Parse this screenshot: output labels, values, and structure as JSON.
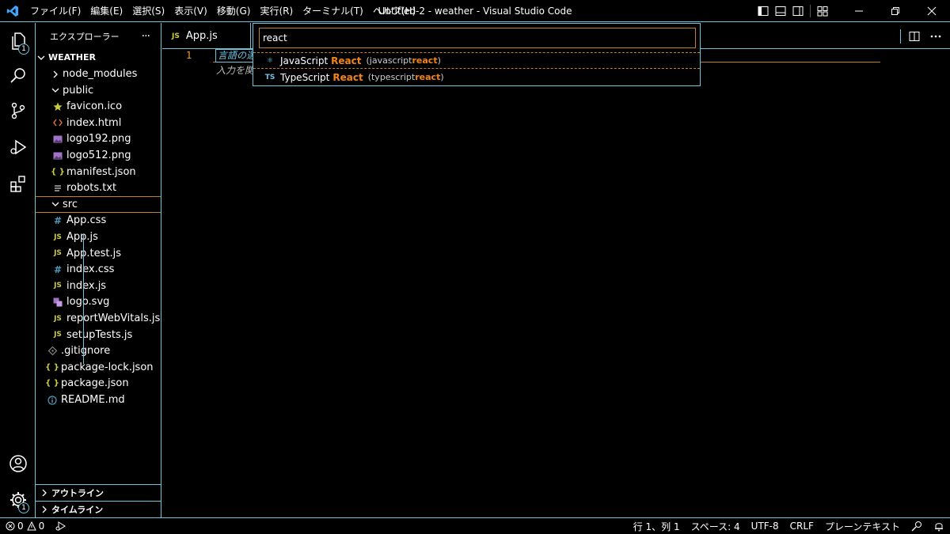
{
  "titlebar": {
    "menus": [
      "ファイル(F)",
      "編集(E)",
      "選択(S)",
      "表示(V)",
      "移動(G)",
      "実行(R)",
      "ターミナル(T)",
      "ヘルプ(H)"
    ],
    "title": "Untitled-2 - weather - Visual Studio Code"
  },
  "activity": {
    "explorer_badge": "1",
    "settings_badge": "1"
  },
  "sidebar": {
    "header": "エクスプローラー",
    "more": "···",
    "root": "WEATHER",
    "items": [
      {
        "label": "node_modules",
        "icon": "chevron-right",
        "indent": 1
      },
      {
        "label": "public",
        "icon": "chevron-down",
        "indent": 1
      },
      {
        "label": "favicon.ico",
        "icon": "star-icon",
        "indent": 2
      },
      {
        "label": "index.html",
        "icon": "html-icon",
        "indent": 2
      },
      {
        "label": "logo192.png",
        "icon": "image-icon",
        "indent": 2
      },
      {
        "label": "logo512.png",
        "icon": "image-icon",
        "indent": 2
      },
      {
        "label": "manifest.json",
        "icon": "json-icon",
        "indent": 2
      },
      {
        "label": "robots.txt",
        "icon": "text-icon",
        "indent": 2
      },
      {
        "label": "src",
        "icon": "chevron-down",
        "indent": 1
      },
      {
        "label": "App.css",
        "icon": "css-icon",
        "indent": 2
      },
      {
        "label": "App.js",
        "icon": "js-icon",
        "indent": 2
      },
      {
        "label": "App.test.js",
        "icon": "js-icon",
        "indent": 2
      },
      {
        "label": "index.css",
        "icon": "css-icon",
        "indent": 2
      },
      {
        "label": "index.js",
        "icon": "js-icon",
        "indent": 2
      },
      {
        "label": "logo.svg",
        "icon": "svg-icon",
        "indent": 2
      },
      {
        "label": "reportWebVitals.js",
        "icon": "js-icon",
        "indent": 2
      },
      {
        "label": "setupTests.js",
        "icon": "js-icon",
        "indent": 2
      },
      {
        "label": ".gitignore",
        "icon": "git-icon",
        "indent": 1
      },
      {
        "label": "package-lock.json",
        "icon": "json-icon",
        "indent": 1
      },
      {
        "label": "package.json",
        "icon": "json-icon",
        "indent": 1
      },
      {
        "label": "README.md",
        "icon": "info-icon",
        "indent": 1
      }
    ],
    "outline": "アウトライン",
    "timeline": "タイムライン"
  },
  "editor": {
    "tab_label": "App.js",
    "tab_icon_text": "JS",
    "line_number": "1",
    "hint_line1": "言語の選",
    "hint_line2": "入力を関"
  },
  "quickpick": {
    "input_value": "react",
    "items": [
      {
        "icon_text": "⚛",
        "name": "JavaScript",
        "match": "React",
        "desc_prefix": "(javascript",
        "desc_match": "react",
        "desc_suffix": ")"
      },
      {
        "icon_text": "TS",
        "name": "TypeScript",
        "match": "React",
        "desc_prefix": "(typescript",
        "desc_match": "react",
        "desc_suffix": ")"
      }
    ]
  },
  "statusbar": {
    "errors": "0",
    "warnings": "0",
    "position": "行 1、列 1",
    "spaces": "スペース: 4",
    "encoding": "UTF-8",
    "eol": "CRLF",
    "language": "プレーンテキスト"
  },
  "colors": {
    "contrast_border": "#6fc3df",
    "active_border": "#c47f2a",
    "highlight": "#f38518",
    "js_icon": "#cbcb41",
    "css_icon": "#519aba",
    "json_icon": "#cbcb41",
    "html_icon": "#e37933",
    "image_icon": "#a074c4"
  }
}
